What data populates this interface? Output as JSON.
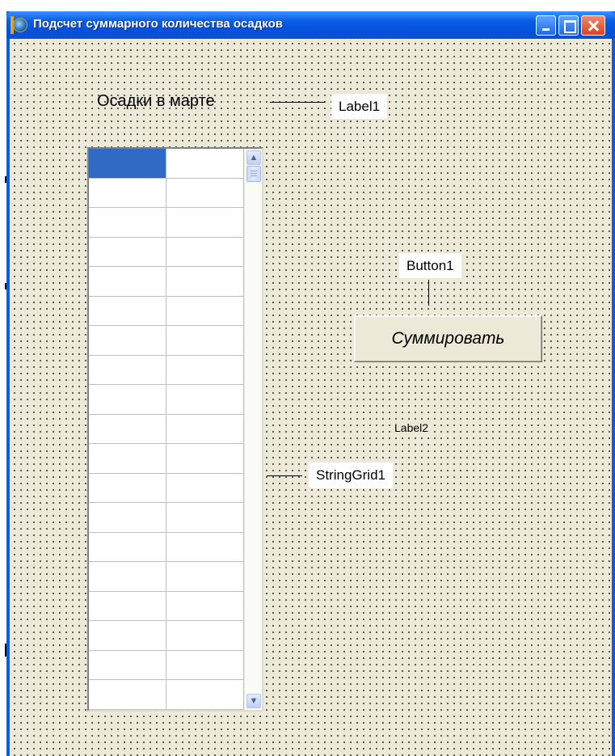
{
  "window": {
    "title": "Подсчет суммарного количества осадков",
    "icon": "delphi-app-icon",
    "controls": [
      "minimize-icon",
      "maximize-icon",
      "close-icon"
    ]
  },
  "form": {
    "heading": "Осадки в марте",
    "action_button": "Суммировать",
    "result_label": "Label2"
  },
  "callouts": {
    "label1": "Label1",
    "button1": "Button1",
    "stringgrid1": "StringGrid1"
  },
  "string_grid": {
    "columns": 2,
    "visible_rows": 19,
    "selected_cell": [
      0,
      0
    ],
    "selection_color": "#316ac5",
    "cells": []
  },
  "colors": {
    "form_background": "#ece9d8",
    "titlebar": "#0a5ce6"
  }
}
